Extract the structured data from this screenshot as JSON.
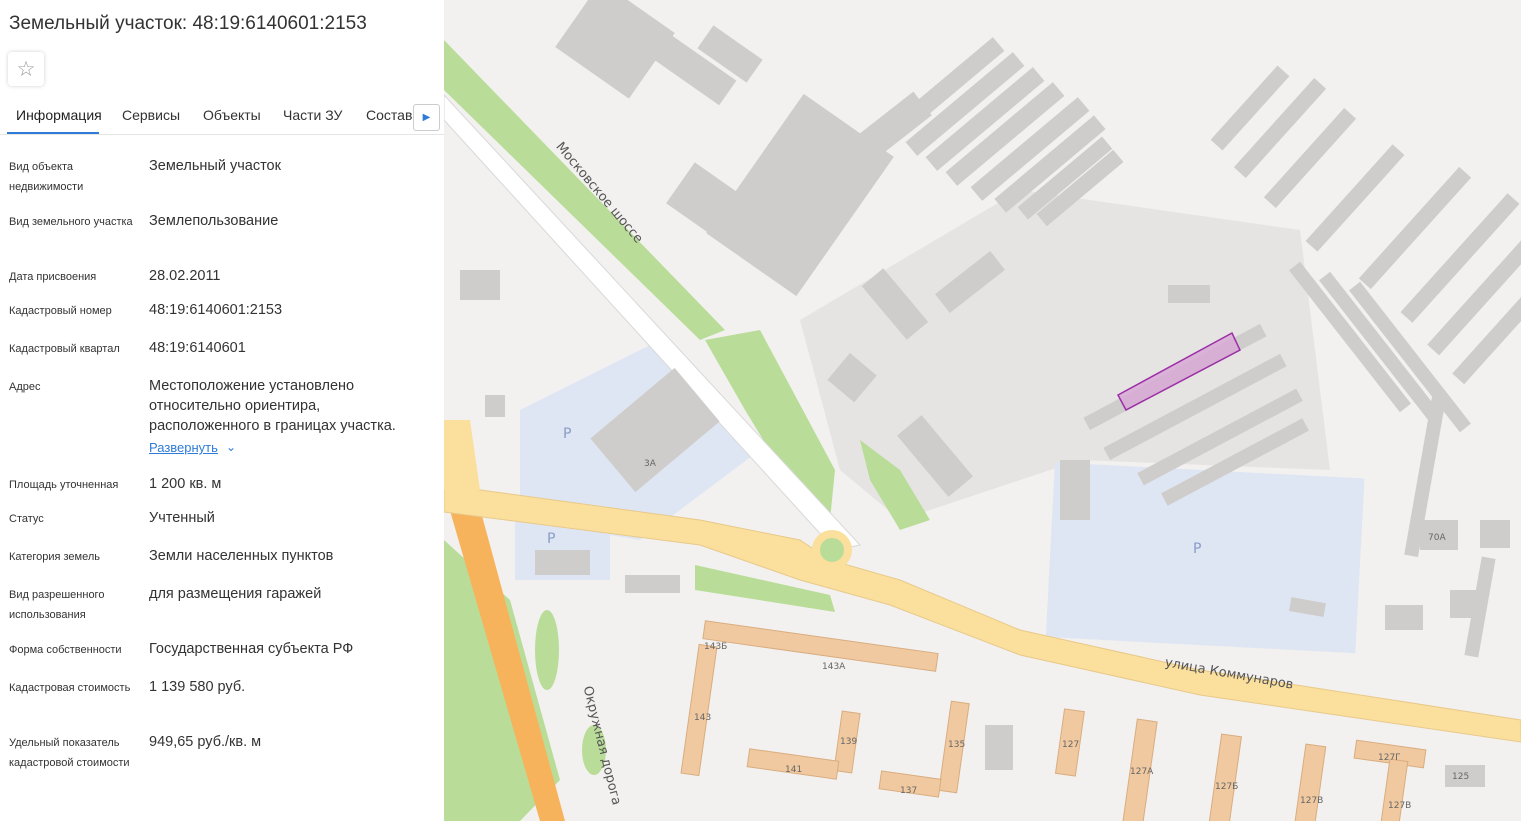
{
  "header": {
    "title": "Земельный участок: 48:19:6140601:2153"
  },
  "favorite": {
    "icon": "star-icon",
    "glyph": "☆"
  },
  "tabs": [
    {
      "label": "Информация",
      "active": true
    },
    {
      "label": "Сервисы",
      "active": false
    },
    {
      "label": "Объекты",
      "active": false
    },
    {
      "label": "Части ЗУ",
      "active": false
    },
    {
      "label": "Состав",
      "active": false
    }
  ],
  "tabs_next": {
    "icon": "caret-right-icon",
    "glyph": "▶"
  },
  "info": {
    "object_type": {
      "label": "Вид объекта недвижимости",
      "value": "Земельный участок"
    },
    "land_type": {
      "label": "Вид земельного участка",
      "value": "Землепользование"
    },
    "assign_date": {
      "label": "Дата присвоения",
      "value": "28.02.2011"
    },
    "cadastral_number": {
      "label": "Кадастровый номер",
      "value": "48:19:6140601:2153"
    },
    "cadastral_quarter": {
      "label": "Кадастровый квартал",
      "value": "48:19:6140601"
    },
    "address": {
      "label": "Адрес",
      "value": "Местоположение установлено относительно ориентира, расположенного в границах участка.",
      "expand_label": "Развернуть",
      "expand_icon": "chevron-down-icon",
      "expand_glyph": "⌄"
    },
    "area": {
      "label": "Площадь уточненная",
      "value": "1 200 кв. м"
    },
    "status": {
      "label": "Статус",
      "value": "Учтенный"
    },
    "land_category": {
      "label": "Категория земель",
      "value": "Земли населенных пунктов"
    },
    "permitted_use": {
      "label": "Вид разрешенного использования",
      "value": "для размещения гаражей"
    },
    "ownership": {
      "label": "Форма собственности",
      "value": "Государственная субъекта РФ"
    },
    "cadastral_value": {
      "label": "Кадастровая стоимость",
      "value": "1 139 580 руб."
    },
    "specific_value": {
      "label": "Удельный показатель кадастровой стоимости",
      "value": "949,65 руб./кв. м"
    }
  },
  "map": {
    "streets": {
      "moskovskoe": "Московское шоссе",
      "kommunarov": "улица Коммунаров",
      "okruzhnaya": "Окружная дорога"
    },
    "parking": [
      "P",
      "P",
      "P"
    ],
    "house_numbers": [
      "3А",
      "70А",
      "143Б",
      "143А",
      "143",
      "139",
      "135",
      "141",
      "137",
      "127",
      "127А",
      "127Б",
      "127В",
      "127Г",
      "127В",
      "125"
    ],
    "colors": {
      "background": "#f2f1ef",
      "building": "#cfcdcb",
      "residential": "#f0c9a0",
      "road": "#fbdf9c",
      "major_road": "#f7b35c",
      "park": "#b9dd98",
      "parking_area": "#dfe6f3",
      "plot_fill": "#d8a9d6",
      "plot_stroke": "#9b2fa6",
      "accent": "#2f7bd8"
    }
  }
}
